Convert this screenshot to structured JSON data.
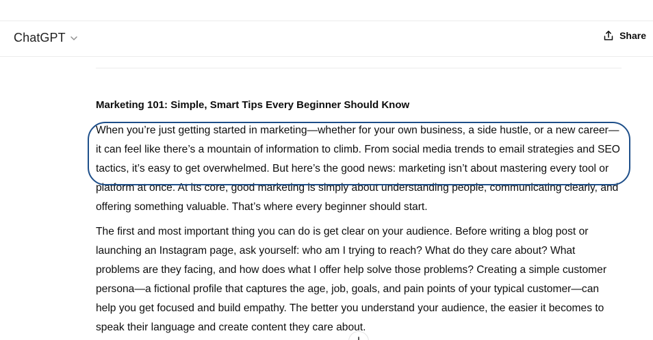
{
  "header": {
    "model_name": "ChatGPT",
    "share_label": "Share"
  },
  "article": {
    "title": "Marketing 101: Simple, Smart Tips Every Beginner Should Know",
    "paragraphs": [
      "When you’re just getting started in marketing—whether for your own business, a side hustle, or a new career—it can feel like there’s a mountain of information to climb. From social media trends to email strategies and SEO tactics, it’s easy to get overwhelmed. But here’s the good news: marketing isn’t about mastering every tool or platform at once. At its core, good marketing is simply about understanding people, communicating clearly, and offering something valuable. That’s where every beginner should start.",
      "The first and most important thing you can do is get clear on your audience. Before writing a blog post or launching an Instagram page, ask yourself: who am I trying to reach? What do they care about? What problems are they facing, and how does what I offer help solve those problems? Creating a simple customer persona—a fictional profile that captures the age, job, goals, and pain points of your typical customer—can help you get focused and build empathy. The better you understand your audience, the easier it becomes to speak their language and create content they care about."
    ]
  },
  "icons": {
    "model_dropdown": "chevron-down-icon",
    "share": "share-icon",
    "scroll": "arrow-down-icon"
  },
  "colors": {
    "annotation_outline": "#1d4e89",
    "text": "#0d0d0d",
    "border": "#ececec"
  }
}
